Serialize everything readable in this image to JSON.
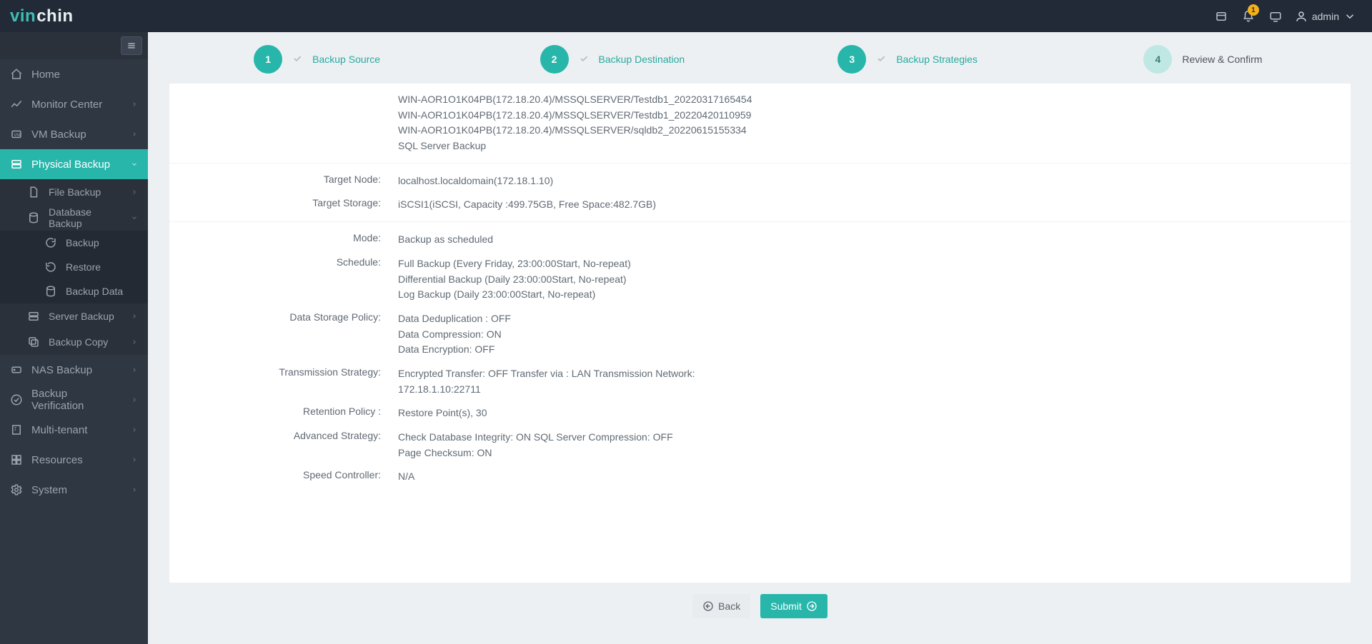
{
  "topbar": {
    "logo_a": "vin",
    "logo_b": "chin",
    "notif_count": "1",
    "user": "admin"
  },
  "sidebar": {
    "items": [
      {
        "label": "Home"
      },
      {
        "label": "Monitor Center"
      },
      {
        "label": "VM Backup"
      },
      {
        "label": "Physical Backup"
      },
      {
        "label": "NAS Backup"
      },
      {
        "label": "Backup Verification"
      },
      {
        "label": "Multi-tenant"
      },
      {
        "label": "Resources"
      },
      {
        "label": "System"
      }
    ],
    "physical_sub": [
      {
        "label": "File Backup"
      },
      {
        "label": "Database Backup"
      },
      {
        "label": "Server Backup"
      },
      {
        "label": "Backup Copy"
      }
    ],
    "db_sub": [
      {
        "label": "Backup"
      },
      {
        "label": "Restore"
      },
      {
        "label": "Backup Data"
      }
    ]
  },
  "wizard": {
    "s1": {
      "num": "1",
      "label": "Backup Source"
    },
    "s2": {
      "num": "2",
      "label": "Backup Destination"
    },
    "s3": {
      "num": "3",
      "label": "Backup Strategies"
    },
    "s4": {
      "num": "4",
      "label": "Review & Confirm"
    }
  },
  "review": {
    "source_lines": [
      "WIN-AOR1O1K04PB(172.18.20.4)/MSSQLSERVER/Testdb1_20220317165454",
      "WIN-AOR1O1K04PB(172.18.20.4)/MSSQLSERVER/Testdb1_20220420110959",
      "WIN-AOR1O1K04PB(172.18.20.4)/MSSQLSERVER/sqldb2_20220615155334",
      "SQL Server Backup"
    ],
    "target_node_label": "Target Node:",
    "target_node": "localhost.localdomain(172.18.1.10)",
    "target_storage_label": "Target Storage:",
    "target_storage": "iSCSI1(iSCSI, Capacity :499.75GB, Free Space:482.7GB)",
    "mode_label": "Mode:",
    "mode": "Backup as scheduled",
    "schedule_label": "Schedule:",
    "schedule_lines": [
      "Full Backup (Every Friday, 23:00:00Start, No-repeat)",
      "Differential Backup (Daily 23:00:00Start, No-repeat)",
      "Log Backup (Daily 23:00:00Start, No-repeat)"
    ],
    "dsp_label": "Data Storage Policy:",
    "dsp_lines": [
      "Data Deduplication : OFF",
      "Data Compression: ON",
      "Data Encryption: OFF"
    ],
    "trans_label": "Transmission Strategy:",
    "trans_lines": [
      "Encrypted Transfer: OFF Transfer via : LAN Transmission Network:",
      "172.18.1.10:22711"
    ],
    "retention_label": "Retention Policy :",
    "retention": "Restore Point(s), 30",
    "advanced_label": "Advanced Strategy:",
    "advanced_lines": [
      "Check Database Integrity: ON SQL Server Compression: OFF",
      "Page Checksum: ON"
    ],
    "speed_label": "Speed Controller:",
    "speed": "N/A"
  },
  "buttons": {
    "back": "Back",
    "submit": "Submit"
  }
}
